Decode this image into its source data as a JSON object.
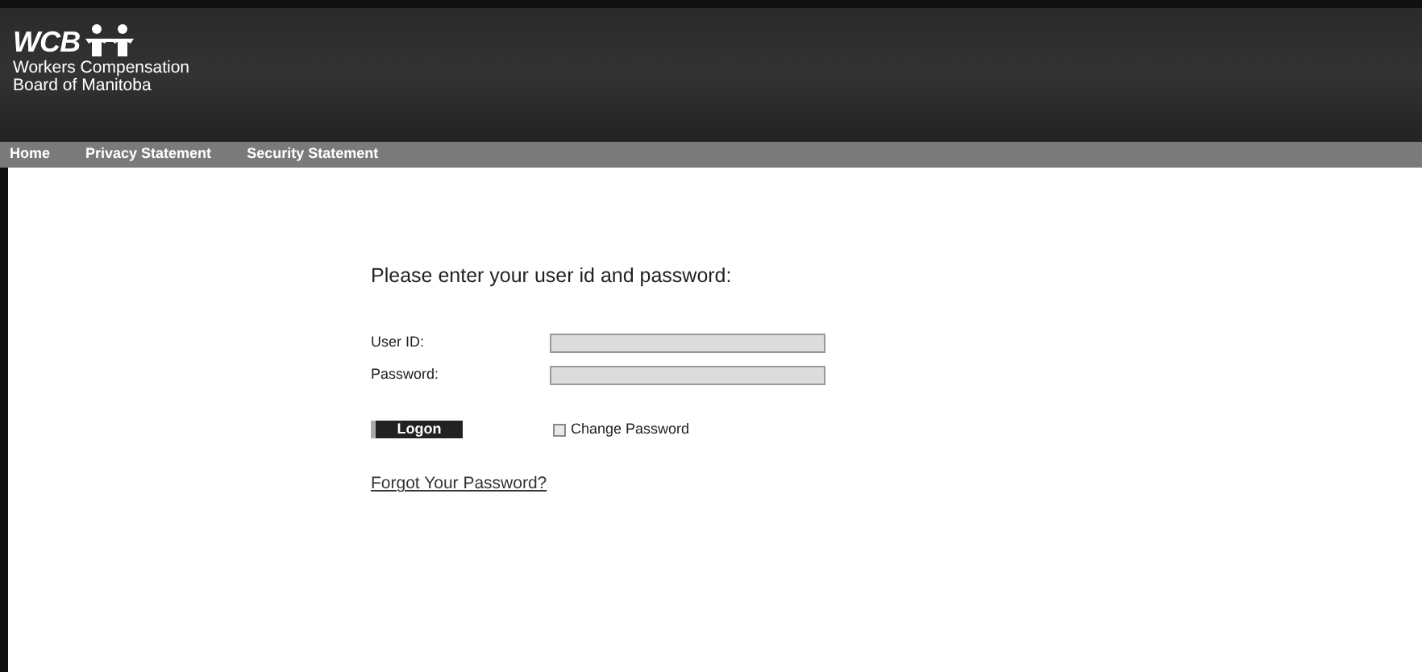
{
  "header": {
    "logo_text": "WCB",
    "org_line_1": "Workers Compensation",
    "org_line_2": "Board of Manitoba"
  },
  "nav": [
    {
      "label": "Home"
    },
    {
      "label": "Privacy Statement"
    },
    {
      "label": "Security Statement"
    }
  ],
  "login": {
    "heading": "Please enter your user id and password:",
    "fields": [
      {
        "label": "User ID:"
      },
      {
        "label": "Password:"
      }
    ],
    "logon_button": "Logon",
    "change_password": {
      "label": "Change Password",
      "checked": false
    },
    "forgot_link": "Forgot Your Password?"
  }
}
